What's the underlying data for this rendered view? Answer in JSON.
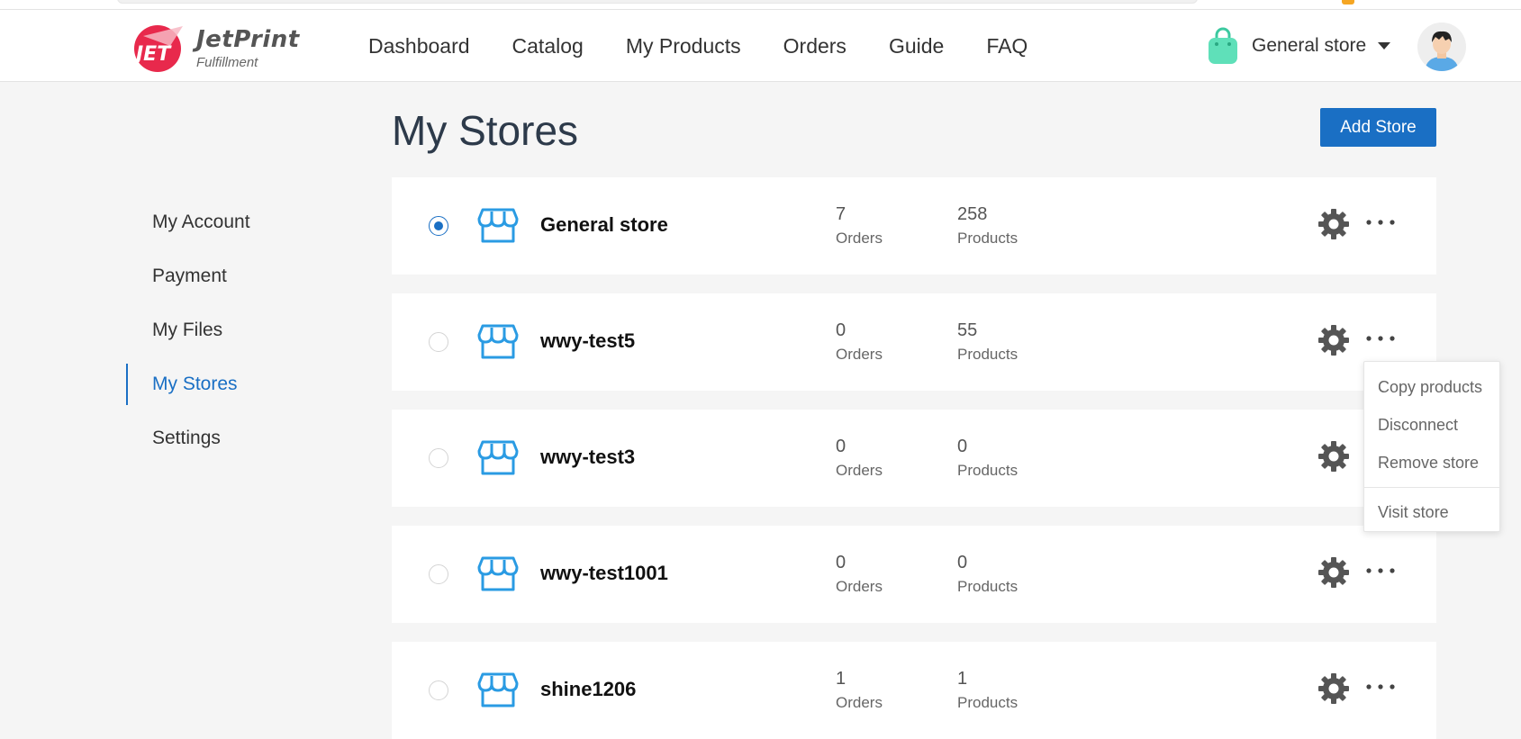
{
  "brand": {
    "name": "JetPrint",
    "tagline": "Fulfillment",
    "logo_text": "JET",
    "primary_color": "#1a6fc4",
    "logo_color": "#e8294c"
  },
  "nav": {
    "items": [
      {
        "label": "Dashboard"
      },
      {
        "label": "Catalog"
      },
      {
        "label": "My Products"
      },
      {
        "label": "Orders"
      },
      {
        "label": "Guide"
      },
      {
        "label": "FAQ"
      }
    ]
  },
  "store_switcher": {
    "selected": "General store",
    "icon": "shopping-bag-icon"
  },
  "sidebar": {
    "items": [
      {
        "label": "My Account",
        "active": false
      },
      {
        "label": "Payment",
        "active": false
      },
      {
        "label": "My Files",
        "active": false
      },
      {
        "label": "My Stores",
        "active": true
      },
      {
        "label": "Settings",
        "active": false
      }
    ]
  },
  "main": {
    "title": "My Stores",
    "add_store_label": "Add Store",
    "orders_label": "Orders",
    "products_label": "Products",
    "stores": [
      {
        "name": "General store",
        "orders": "7",
        "products": "258",
        "selected": true
      },
      {
        "name": "wwy-test5",
        "orders": "0",
        "products": "55",
        "selected": false
      },
      {
        "name": "wwy-test3",
        "orders": "0",
        "products": "0",
        "selected": false
      },
      {
        "name": "wwy-test1001",
        "orders": "0",
        "products": "0",
        "selected": false
      },
      {
        "name": "shine1206",
        "orders": "1",
        "products": "1",
        "selected": false
      }
    ]
  },
  "store_menu": {
    "items": [
      {
        "label": "Copy products"
      },
      {
        "label": "Disconnect"
      },
      {
        "label": "Remove store"
      },
      {
        "label": "Visit store"
      }
    ]
  }
}
